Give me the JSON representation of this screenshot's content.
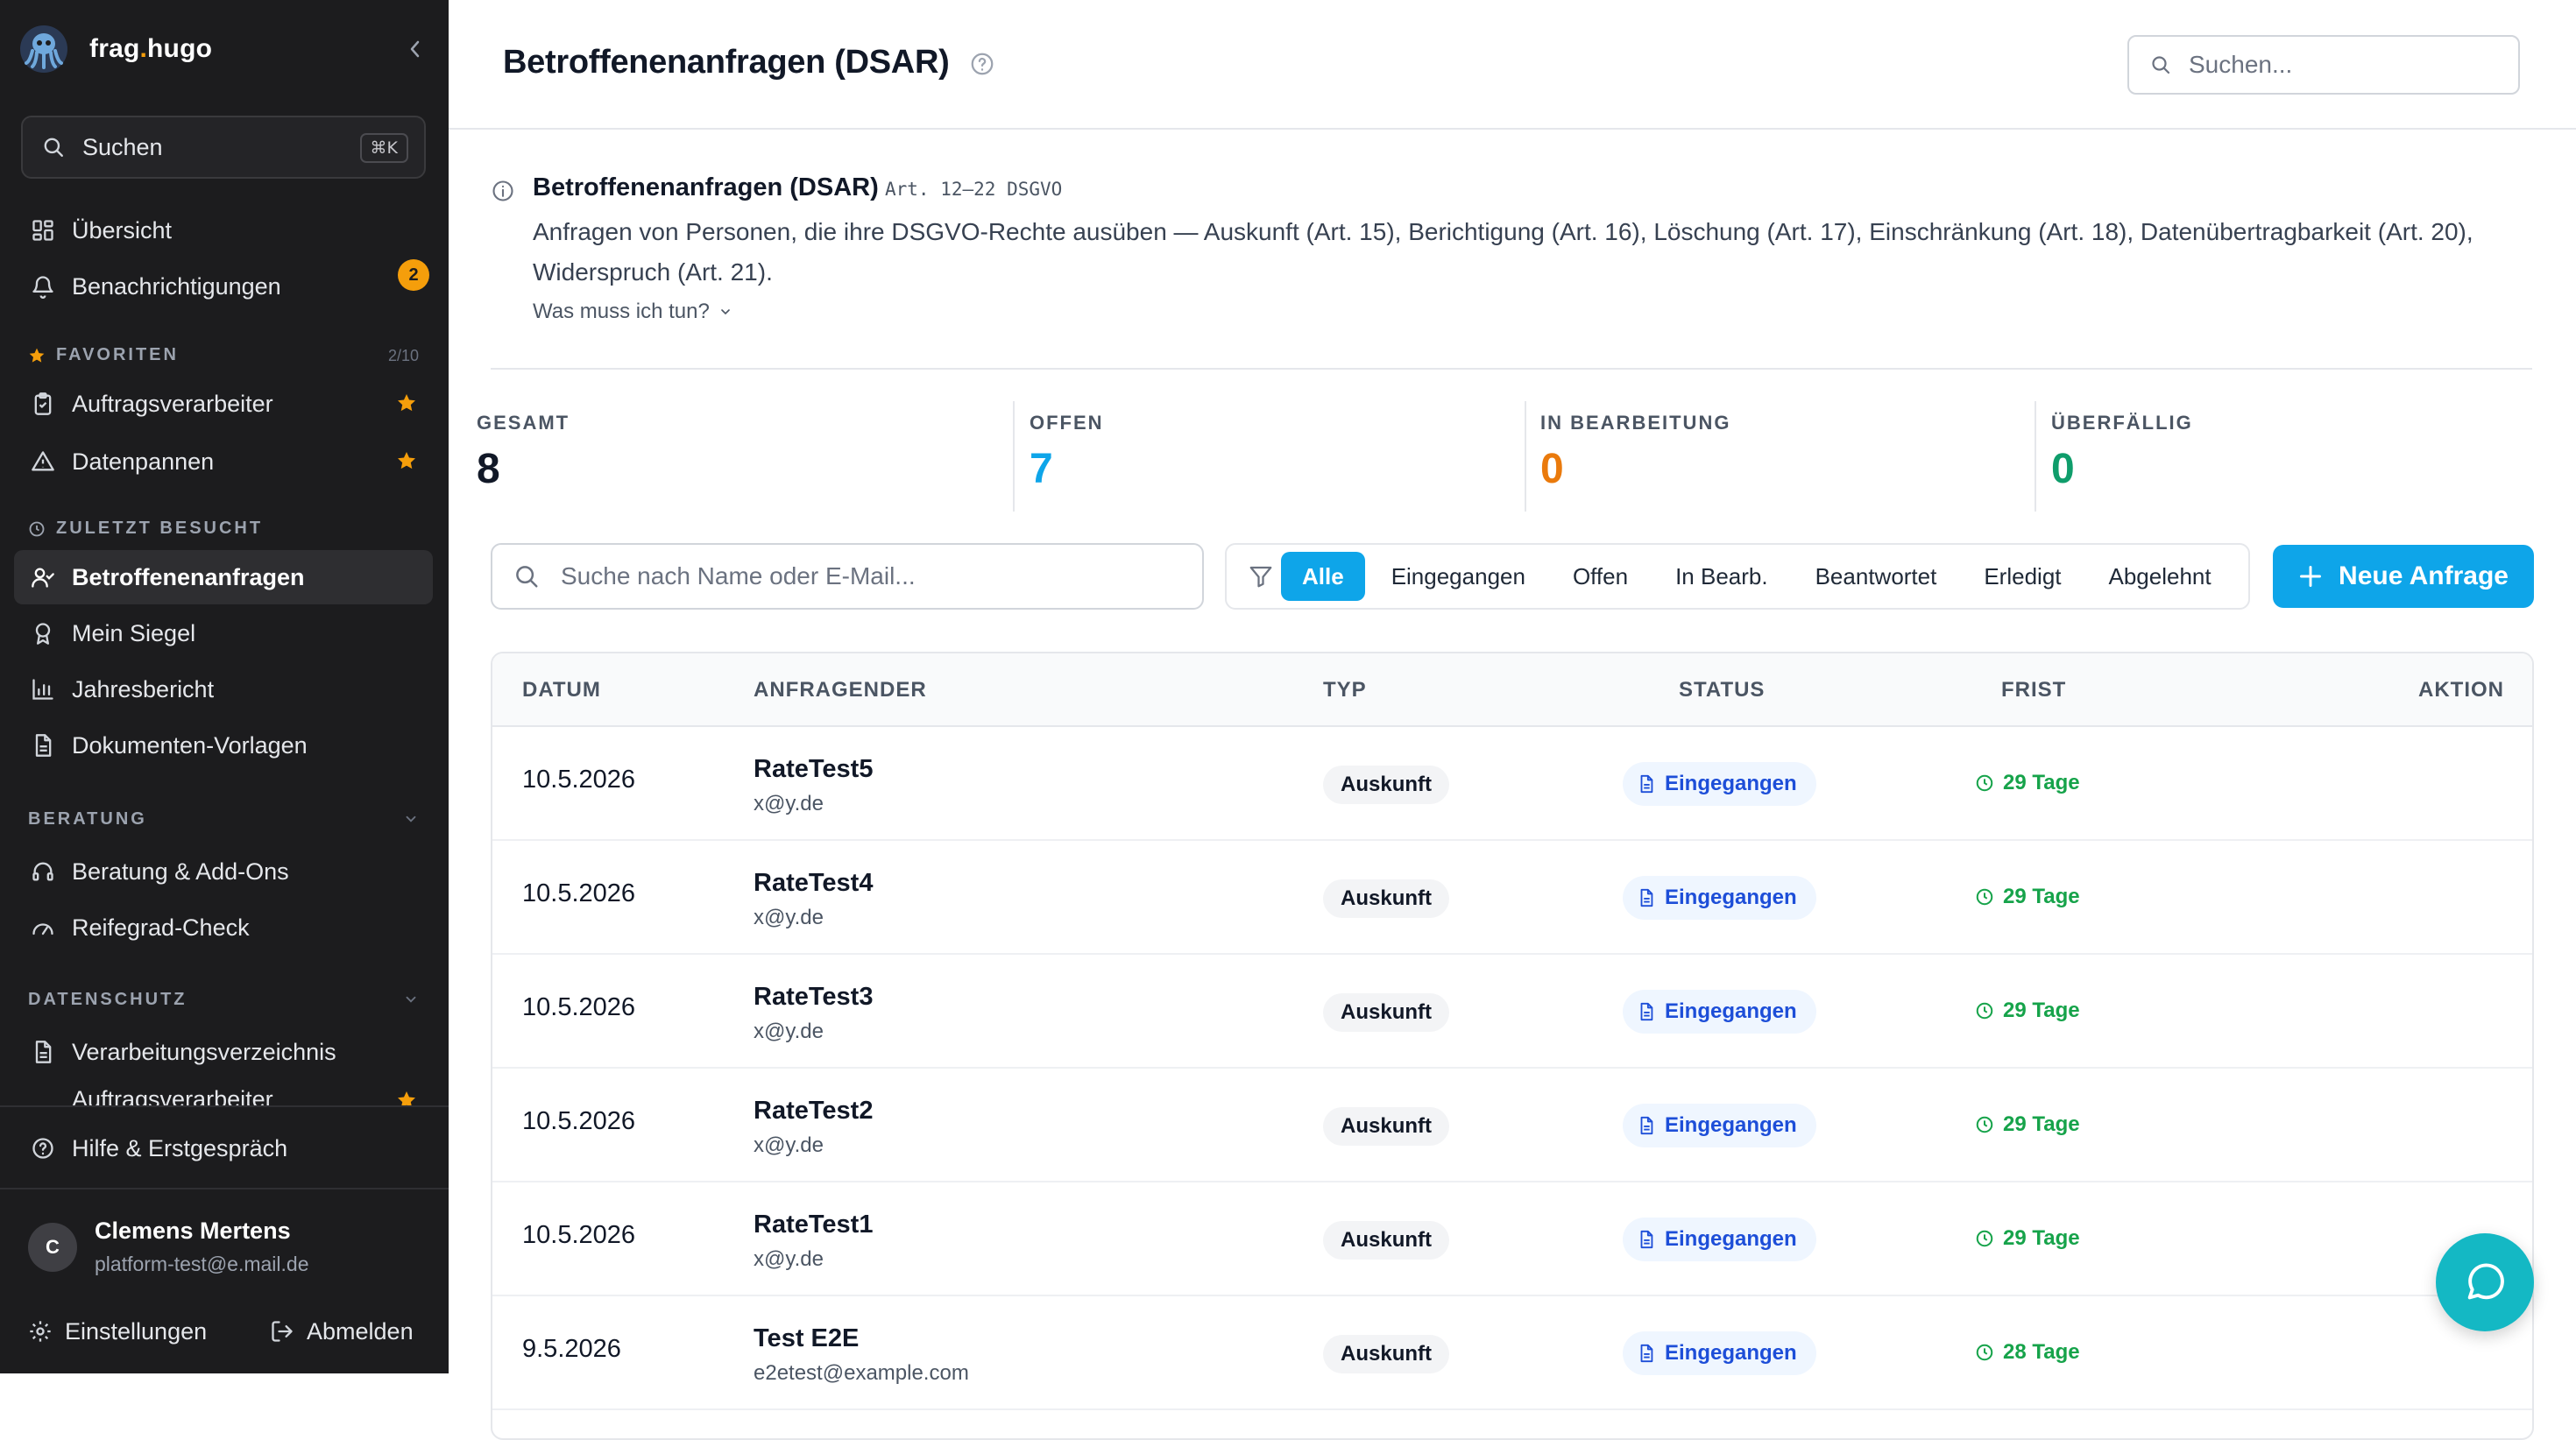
{
  "app": {
    "brand_name": "frag",
    "brand_dot": ".",
    "brand_name2": "hugo"
  },
  "sidebar": {
    "search_label": "Suchen",
    "search_shortcut": "⌘K",
    "main_items": [
      {
        "label": "Übersicht",
        "icon": "grid-icon"
      },
      {
        "label": "Benachrichtigungen",
        "icon": "bell-icon",
        "badge": "2"
      }
    ],
    "favorites": {
      "title": "FAVORITEN",
      "count": "2/10",
      "items": [
        {
          "label": "Auftragsverarbeiter",
          "icon": "clipboard-check-icon"
        },
        {
          "label": "Datenpannen",
          "icon": "warning-icon"
        }
      ]
    },
    "recent": {
      "title": "ZULETZT BESUCHT",
      "items": [
        {
          "label": "Betroffenenanfragen",
          "icon": "user-check-icon",
          "active": true
        },
        {
          "label": "Mein Siegel",
          "icon": "award-icon"
        },
        {
          "label": "Jahresbericht",
          "icon": "bar-chart-icon"
        },
        {
          "label": "Dokumenten-Vorlagen",
          "icon": "document-icon"
        }
      ]
    },
    "beratung": {
      "title": "BERATUNG",
      "items": [
        {
          "label": "Beratung & Add-Ons",
          "icon": "headset-icon"
        },
        {
          "label": "Reifegrad-Check",
          "icon": "gauge-icon"
        }
      ]
    },
    "datenschutz": {
      "title": "DATENSCHUTZ",
      "items": [
        {
          "label": "Verarbeitungsverzeichnis",
          "icon": "document-icon"
        },
        {
          "label": "Auftragsverarbeiter",
          "icon": "clipboard-check-icon"
        }
      ]
    },
    "help_label": "Hilfe & Erstgespräch",
    "user": {
      "initial": "C",
      "name": "Clemens Mertens",
      "email": "platform-test@e.mail.de"
    },
    "settings_label": "Einstellungen",
    "logout_label": "Abmelden"
  },
  "header": {
    "title": "Betroffenenanfragen (DSAR)",
    "search_placeholder": "Suchen..."
  },
  "info": {
    "title": "Betroffenenanfragen (DSAR)",
    "article": "Art. 12–22 DSGVO",
    "description": "Anfragen von Personen, die ihre DSGVO-Rechte ausüben — Auskunft (Art. 15), Berichtigung (Art. 16), Löschung (Art. 17), Einschränkung (Art. 18), Datenübertragbarkeit (Art. 20), Widerspruch (Art. 21).",
    "more_label": "Was muss ich tun?"
  },
  "stats": [
    {
      "label": "GESAMT",
      "value": "8",
      "color": "#111827"
    },
    {
      "label": "OFFEN",
      "value": "7",
      "color": "#0ea5e9"
    },
    {
      "label": "IN BEARBEITUNG",
      "value": "0",
      "color": "#ea7a0c"
    },
    {
      "label": "ÜBERFÄLLIG",
      "value": "0",
      "color": "#0f9d6b"
    }
  ],
  "table_search_placeholder": "Suche nach Name oder E-Mail...",
  "filters": [
    "Alle",
    "Eingegangen",
    "Offen",
    "In Bearb.",
    "Beantwortet",
    "Erledigt",
    "Abgelehnt"
  ],
  "active_filter": "Alle",
  "new_button_label": "Neue Anfrage",
  "table": {
    "columns": [
      "DATUM",
      "ANFRAGENDER",
      "TYP",
      "STATUS",
      "FRIST",
      "AKTION"
    ],
    "rows": [
      {
        "date": "10.5.2026",
        "name": "RateTest5",
        "email": "x@y.de",
        "type": "Auskunft",
        "status": "Eingegangen",
        "deadline": "29 Tage"
      },
      {
        "date": "10.5.2026",
        "name": "RateTest4",
        "email": "x@y.de",
        "type": "Auskunft",
        "status": "Eingegangen",
        "deadline": "29 Tage"
      },
      {
        "date": "10.5.2026",
        "name": "RateTest3",
        "email": "x@y.de",
        "type": "Auskunft",
        "status": "Eingegangen",
        "deadline": "29 Tage"
      },
      {
        "date": "10.5.2026",
        "name": "RateTest2",
        "email": "x@y.de",
        "type": "Auskunft",
        "status": "Eingegangen",
        "deadline": "29 Tage"
      },
      {
        "date": "10.5.2026",
        "name": "RateTest1",
        "email": "x@y.de",
        "type": "Auskunft",
        "status": "Eingegangen",
        "deadline": "29 Tage"
      },
      {
        "date": "9.5.2026",
        "name": "Test E2E",
        "email": "e2etest@example.com",
        "type": "Auskunft",
        "status": "Eingegangen",
        "deadline": "28 Tage"
      }
    ]
  },
  "colors": {
    "accent": "#0ea5e9",
    "sidebar_bg": "#1c1c1e",
    "badge": "#f59e0b",
    "chat": "#14b8c4"
  }
}
